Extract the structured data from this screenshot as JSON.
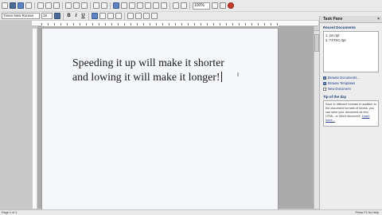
{
  "toolbar": {
    "zoom": "100%",
    "font_name": "Times New Roman",
    "font_size": "16",
    "bold": "B",
    "italic": "I",
    "underline": "U"
  },
  "document": {
    "lines": [
      "Speeding it up will make it shorter",
      "and lowing it will make it longer!"
    ]
  },
  "task_pane": {
    "title": "Task Pane",
    "close": "×",
    "recent_heading": "Recent Documents",
    "recent_items": [
      "1. jon.rtpt",
      "2. TXTXC.rtpt"
    ],
    "links": [
      "Browse Documents...",
      "Browse Templates",
      "New Document"
    ],
    "tip_heading": "Tip of the day",
    "tip_text": "Save in different formats In addition to the document formats of Works, you can save your document as text, HTML, or Word document.",
    "tip_link": "Learn more..."
  },
  "status": {
    "left": "Page 1 of 1",
    "right": "Press F1 for Help"
  }
}
